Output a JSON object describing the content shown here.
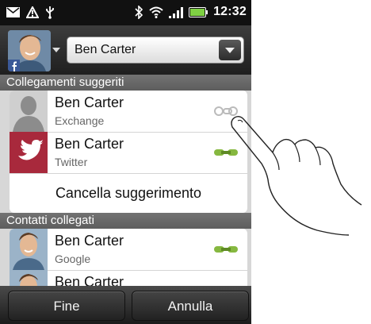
{
  "status_bar": {
    "time": "12:32"
  },
  "header": {
    "selected_name": "Ben Carter"
  },
  "suggested": {
    "section_title": "Collegamenti suggeriti",
    "items": [
      {
        "name": "Ben Carter",
        "source": "Exchange",
        "link_state": "unlinked"
      },
      {
        "name": "Ben Carter",
        "source": "Twitter",
        "link_state": "linked"
      }
    ],
    "cancel_label": "Cancella suggerimento"
  },
  "linked": {
    "section_title": "Contatti collegati",
    "items": [
      {
        "name": "Ben  Carter",
        "source": "Google",
        "link_state": "linked"
      },
      {
        "name": "Ben Carter",
        "source": "",
        "link_state": "linked"
      }
    ]
  },
  "footer": {
    "done_label": "Fine",
    "cancel_label": "Annulla"
  },
  "colors": {
    "link_green": "#86b840",
    "twitter_red": "#a8293c"
  }
}
